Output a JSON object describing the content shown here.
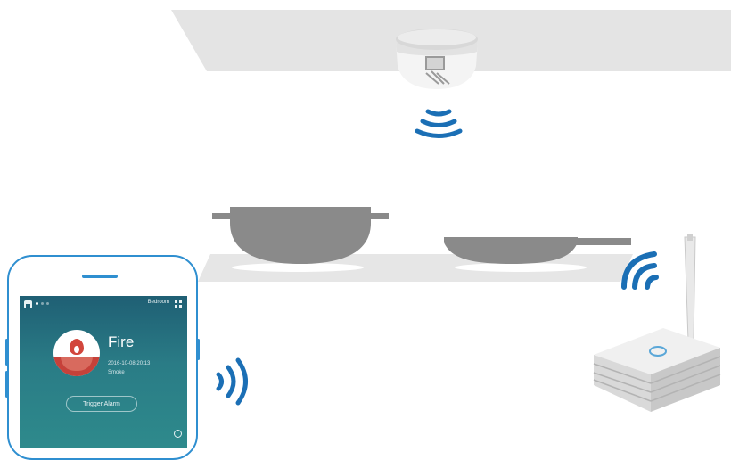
{
  "colors": {
    "accent": "#1b6fb5",
    "ceiling": "#e4e4e4",
    "pan": "#8a8a8a",
    "stove": "#e6e6e6",
    "screen_top": "#1f5f74",
    "screen_bottom": "#2e8a8c",
    "alarm_red": "#c6413a"
  },
  "icons": {
    "detector_signal": "wifi-waves-down",
    "phone_signal": "wifi-waves-right",
    "hub_signal": "wifi-waves-up",
    "room_menu": "grid-icon",
    "home": "home-icon",
    "alarm": "flame-icon",
    "settings": "gear-icon"
  },
  "phone_app": {
    "room": "Bedroom",
    "alarm_title": "Fire",
    "alarm_time": "2016-10-08 20:13",
    "alarm_type": "Smoke",
    "trigger_button": "Trigger Alarm",
    "page_count": 3,
    "active_page": 1
  }
}
